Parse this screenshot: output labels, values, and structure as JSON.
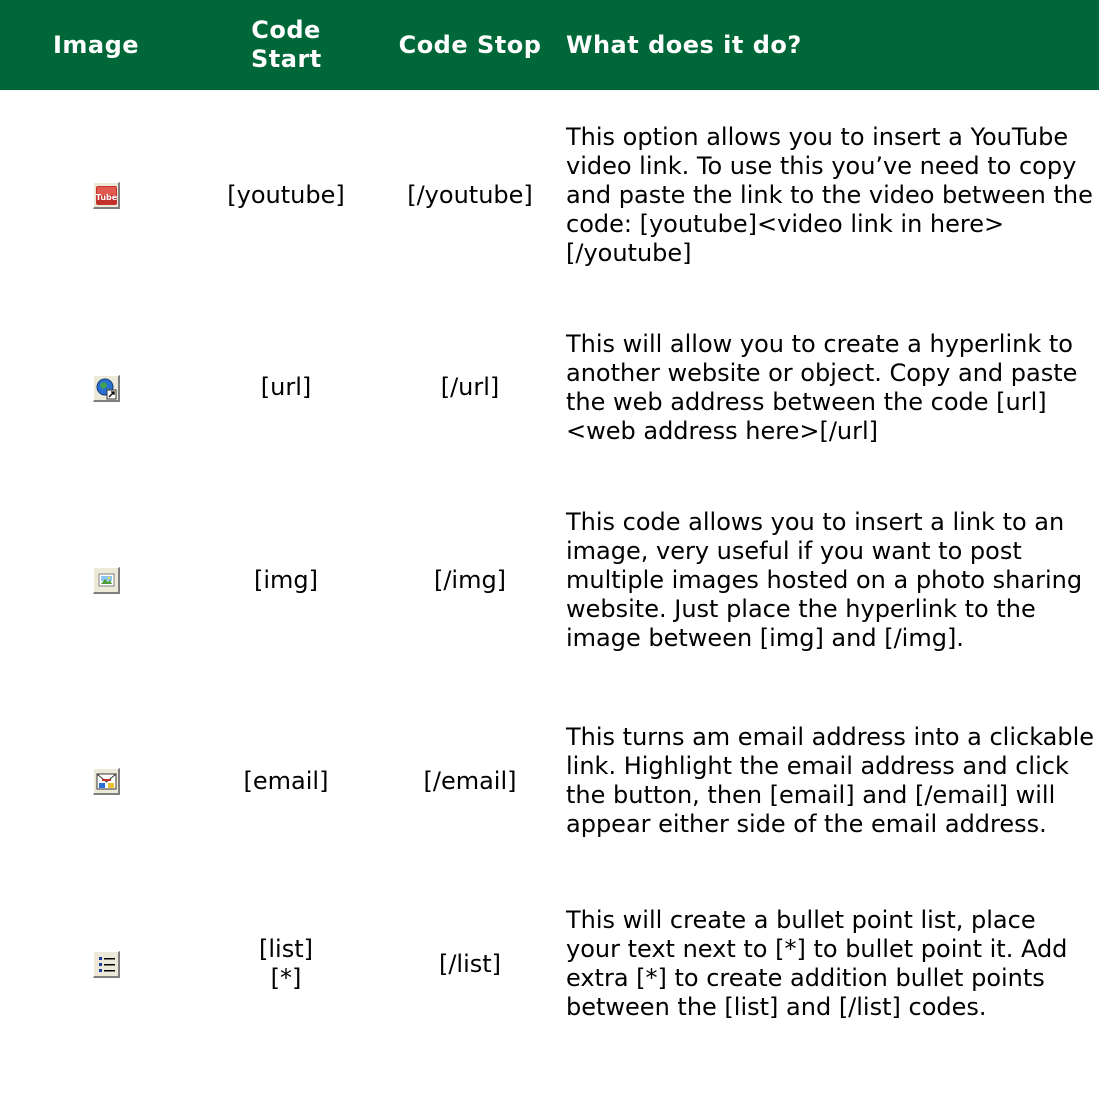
{
  "headers": {
    "image": "Image",
    "code_start": "Code Start",
    "code_stop": "Code Stop",
    "description": "What does it do?"
  },
  "colors": {
    "header_bg": "#006838",
    "header_text": "#ffffff"
  },
  "rows": [
    {
      "icon": "youtube-icon",
      "code_start": "[youtube]",
      "code_stop": "[/youtube]",
      "description": "This option allows you to insert a YouTube video link. To use this you’ve need to copy and paste the link to the video between the code: [youtube]<video link in here>[/youtube]"
    },
    {
      "icon": "globe-link-icon",
      "code_start": "[url]",
      "code_stop": "[/url]",
      "description": "This will allow you to create a hyperlink to another website or object. Copy and paste the web address between the code [url]<web address here>[/url]"
    },
    {
      "icon": "image-icon",
      "code_start": "[img]",
      "code_stop": "[/img]",
      "description": "This code allows you to insert a link to an image, very useful if you want to post multiple images hosted on a photo sharing website. Just place the hyperlink to the image between [img] and [/img]."
    },
    {
      "icon": "email-icon",
      "code_start": "[email]",
      "code_stop": "[/email]",
      "description": "This turns am email address into a clickable link. Highlight the email address and click the button, then [email] and [/email] will appear either side of the email address."
    },
    {
      "icon": "bullet-list-icon",
      "code_start_lines": [
        "[list]",
        "[*]"
      ],
      "code_stop": "[/list]",
      "description": "This will create a bullet point list, place your text next to [*] to bullet point it. Add extra [*] to create addition bullet points between the [list] and [/list] codes."
    }
  ]
}
